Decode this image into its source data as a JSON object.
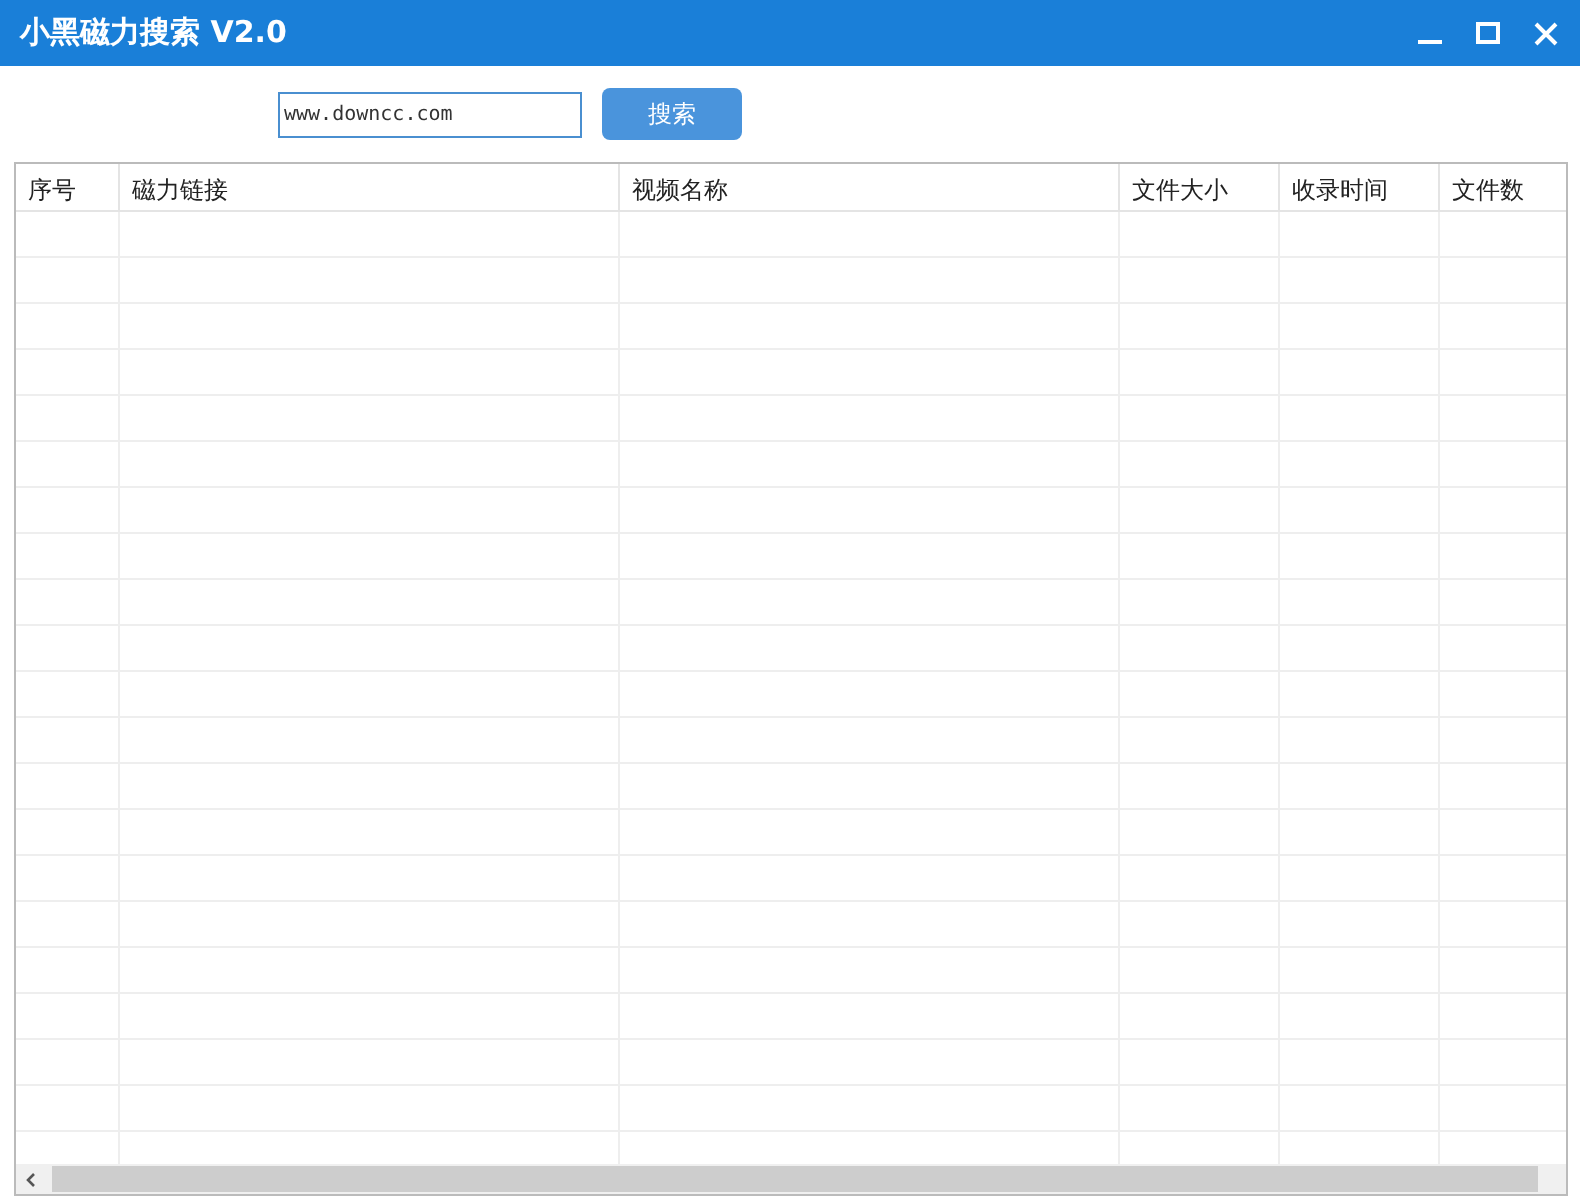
{
  "window": {
    "title": "小黑磁力搜索 V2.0"
  },
  "search": {
    "value": "www.downcc.com",
    "button": "搜索"
  },
  "table": {
    "columns": [
      "序号",
      "磁力链接",
      "视频名称",
      "文件大小",
      "收录时间",
      "文件数"
    ]
  }
}
